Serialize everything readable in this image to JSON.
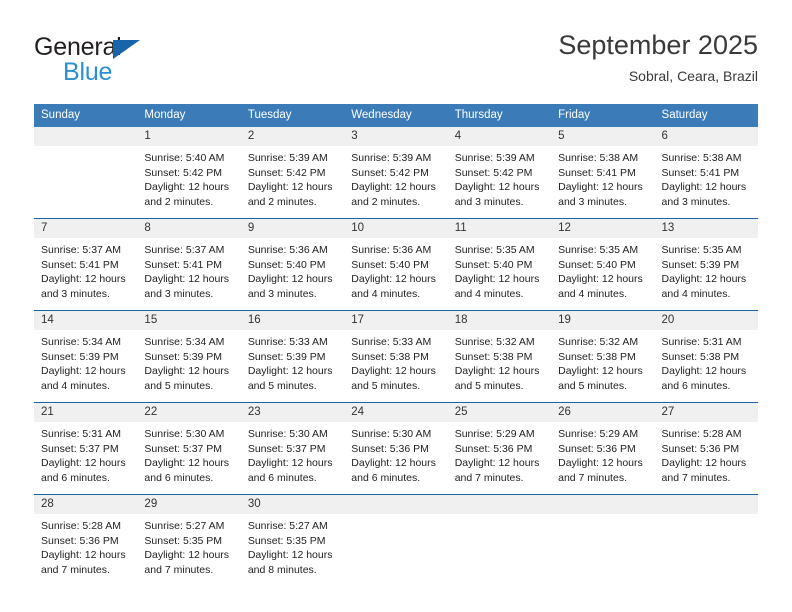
{
  "brand": {
    "name_top": "General",
    "name_bottom": "Blue",
    "logo_icon": "triangle-icon",
    "top_color": "#231f20",
    "bottom_color": "#2a8fd4",
    "triangle_color": "#1565a8"
  },
  "header": {
    "title": "September 2025",
    "subtitle": "Sobral, Ceara, Brazil"
  },
  "theme": {
    "header_bg": "#3b7cb8",
    "header_text": "#ffffff",
    "row_rule": "#1565a8",
    "day_band_bg": "#f0f0f0",
    "cell_bg": "#ffffff",
    "text": "#222222"
  },
  "weekdays": [
    "Sunday",
    "Monday",
    "Tuesday",
    "Wednesday",
    "Thursday",
    "Friday",
    "Saturday"
  ],
  "weeks": [
    [
      {
        "day": "",
        "lines": []
      },
      {
        "day": "1",
        "lines": [
          "Sunrise: 5:40 AM",
          "Sunset: 5:42 PM",
          "Daylight: 12 hours",
          "and 2 minutes."
        ]
      },
      {
        "day": "2",
        "lines": [
          "Sunrise: 5:39 AM",
          "Sunset: 5:42 PM",
          "Daylight: 12 hours",
          "and 2 minutes."
        ]
      },
      {
        "day": "3",
        "lines": [
          "Sunrise: 5:39 AM",
          "Sunset: 5:42 PM",
          "Daylight: 12 hours",
          "and 2 minutes."
        ]
      },
      {
        "day": "4",
        "lines": [
          "Sunrise: 5:39 AM",
          "Sunset: 5:42 PM",
          "Daylight: 12 hours",
          "and 3 minutes."
        ]
      },
      {
        "day": "5",
        "lines": [
          "Sunrise: 5:38 AM",
          "Sunset: 5:41 PM",
          "Daylight: 12 hours",
          "and 3 minutes."
        ]
      },
      {
        "day": "6",
        "lines": [
          "Sunrise: 5:38 AM",
          "Sunset: 5:41 PM",
          "Daylight: 12 hours",
          "and 3 minutes."
        ]
      }
    ],
    [
      {
        "day": "7",
        "lines": [
          "Sunrise: 5:37 AM",
          "Sunset: 5:41 PM",
          "Daylight: 12 hours",
          "and 3 minutes."
        ]
      },
      {
        "day": "8",
        "lines": [
          "Sunrise: 5:37 AM",
          "Sunset: 5:41 PM",
          "Daylight: 12 hours",
          "and 3 minutes."
        ]
      },
      {
        "day": "9",
        "lines": [
          "Sunrise: 5:36 AM",
          "Sunset: 5:40 PM",
          "Daylight: 12 hours",
          "and 3 minutes."
        ]
      },
      {
        "day": "10",
        "lines": [
          "Sunrise: 5:36 AM",
          "Sunset: 5:40 PM",
          "Daylight: 12 hours",
          "and 4 minutes."
        ]
      },
      {
        "day": "11",
        "lines": [
          "Sunrise: 5:35 AM",
          "Sunset: 5:40 PM",
          "Daylight: 12 hours",
          "and 4 minutes."
        ]
      },
      {
        "day": "12",
        "lines": [
          "Sunrise: 5:35 AM",
          "Sunset: 5:40 PM",
          "Daylight: 12 hours",
          "and 4 minutes."
        ]
      },
      {
        "day": "13",
        "lines": [
          "Sunrise: 5:35 AM",
          "Sunset: 5:39 PM",
          "Daylight: 12 hours",
          "and 4 minutes."
        ]
      }
    ],
    [
      {
        "day": "14",
        "lines": [
          "Sunrise: 5:34 AM",
          "Sunset: 5:39 PM",
          "Daylight: 12 hours",
          "and 4 minutes."
        ]
      },
      {
        "day": "15",
        "lines": [
          "Sunrise: 5:34 AM",
          "Sunset: 5:39 PM",
          "Daylight: 12 hours",
          "and 5 minutes."
        ]
      },
      {
        "day": "16",
        "lines": [
          "Sunrise: 5:33 AM",
          "Sunset: 5:39 PM",
          "Daylight: 12 hours",
          "and 5 minutes."
        ]
      },
      {
        "day": "17",
        "lines": [
          "Sunrise: 5:33 AM",
          "Sunset: 5:38 PM",
          "Daylight: 12 hours",
          "and 5 minutes."
        ]
      },
      {
        "day": "18",
        "lines": [
          "Sunrise: 5:32 AM",
          "Sunset: 5:38 PM",
          "Daylight: 12 hours",
          "and 5 minutes."
        ]
      },
      {
        "day": "19",
        "lines": [
          "Sunrise: 5:32 AM",
          "Sunset: 5:38 PM",
          "Daylight: 12 hours",
          "and 5 minutes."
        ]
      },
      {
        "day": "20",
        "lines": [
          "Sunrise: 5:31 AM",
          "Sunset: 5:38 PM",
          "Daylight: 12 hours",
          "and 6 minutes."
        ]
      }
    ],
    [
      {
        "day": "21",
        "lines": [
          "Sunrise: 5:31 AM",
          "Sunset: 5:37 PM",
          "Daylight: 12 hours",
          "and 6 minutes."
        ]
      },
      {
        "day": "22",
        "lines": [
          "Sunrise: 5:30 AM",
          "Sunset: 5:37 PM",
          "Daylight: 12 hours",
          "and 6 minutes."
        ]
      },
      {
        "day": "23",
        "lines": [
          "Sunrise: 5:30 AM",
          "Sunset: 5:37 PM",
          "Daylight: 12 hours",
          "and 6 minutes."
        ]
      },
      {
        "day": "24",
        "lines": [
          "Sunrise: 5:30 AM",
          "Sunset: 5:36 PM",
          "Daylight: 12 hours",
          "and 6 minutes."
        ]
      },
      {
        "day": "25",
        "lines": [
          "Sunrise: 5:29 AM",
          "Sunset: 5:36 PM",
          "Daylight: 12 hours",
          "and 7 minutes."
        ]
      },
      {
        "day": "26",
        "lines": [
          "Sunrise: 5:29 AM",
          "Sunset: 5:36 PM",
          "Daylight: 12 hours",
          "and 7 minutes."
        ]
      },
      {
        "day": "27",
        "lines": [
          "Sunrise: 5:28 AM",
          "Sunset: 5:36 PM",
          "Daylight: 12 hours",
          "and 7 minutes."
        ]
      }
    ],
    [
      {
        "day": "28",
        "lines": [
          "Sunrise: 5:28 AM",
          "Sunset: 5:36 PM",
          "Daylight: 12 hours",
          "and 7 minutes."
        ]
      },
      {
        "day": "29",
        "lines": [
          "Sunrise: 5:27 AM",
          "Sunset: 5:35 PM",
          "Daylight: 12 hours",
          "and 7 minutes."
        ]
      },
      {
        "day": "30",
        "lines": [
          "Sunrise: 5:27 AM",
          "Sunset: 5:35 PM",
          "Daylight: 12 hours",
          "and 8 minutes."
        ]
      },
      {
        "day": "",
        "lines": []
      },
      {
        "day": "",
        "lines": []
      },
      {
        "day": "",
        "lines": []
      },
      {
        "day": "",
        "lines": []
      }
    ]
  ]
}
